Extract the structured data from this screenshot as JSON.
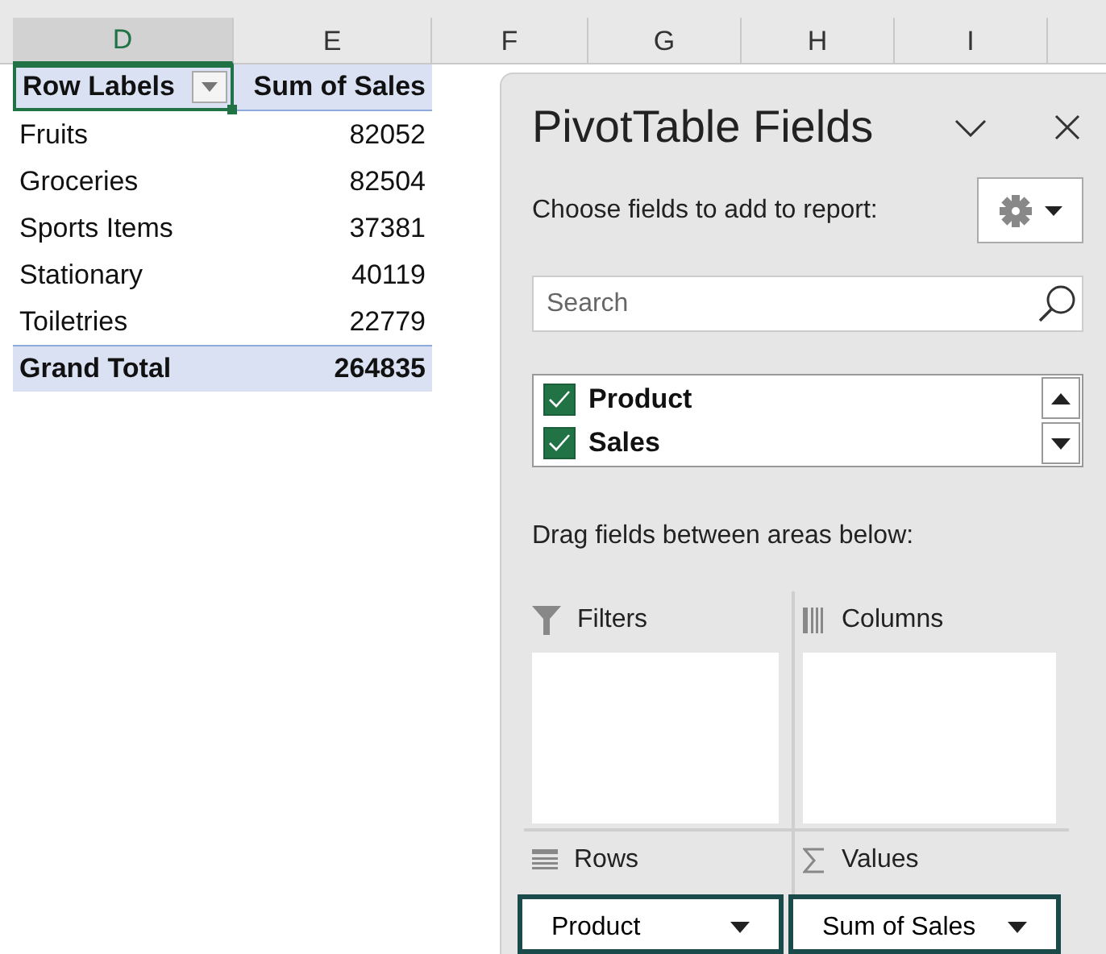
{
  "column_headers": [
    {
      "label": "D",
      "selected": true
    },
    {
      "label": "E",
      "selected": false
    },
    {
      "label": "F",
      "selected": false
    },
    {
      "label": "G",
      "selected": false
    },
    {
      "label": "H",
      "selected": false
    },
    {
      "label": "I",
      "selected": false
    }
  ],
  "pivot_table": {
    "header": {
      "row_labels": "Row Labels",
      "sum_label": "Sum of Sales"
    },
    "rows": [
      {
        "label": "Fruits",
        "value": "82052"
      },
      {
        "label": "Groceries",
        "value": "82504"
      },
      {
        "label": "Sports Items",
        "value": "37381"
      },
      {
        "label": "Stationary",
        "value": "40119"
      },
      {
        "label": "Toiletries",
        "value": "22779"
      }
    ],
    "grand_total": {
      "label": "Grand Total",
      "value": "264835"
    }
  },
  "panel": {
    "title": "PivotTable Fields",
    "prompt": "Choose fields to add to report:",
    "search": {
      "placeholder": "Search"
    },
    "fields": [
      {
        "label": "Product",
        "checked": true
      },
      {
        "label": "Sales",
        "checked": true
      }
    ],
    "drag_hint": "Drag fields between areas below:",
    "areas": [
      {
        "kind": "filters",
        "label": "Filters"
      },
      {
        "kind": "columns",
        "label": "Columns"
      },
      {
        "kind": "rows",
        "label": "Rows",
        "item": "Product"
      },
      {
        "kind": "values",
        "label": "Values",
        "item": "Sum of Sales"
      }
    ]
  }
}
